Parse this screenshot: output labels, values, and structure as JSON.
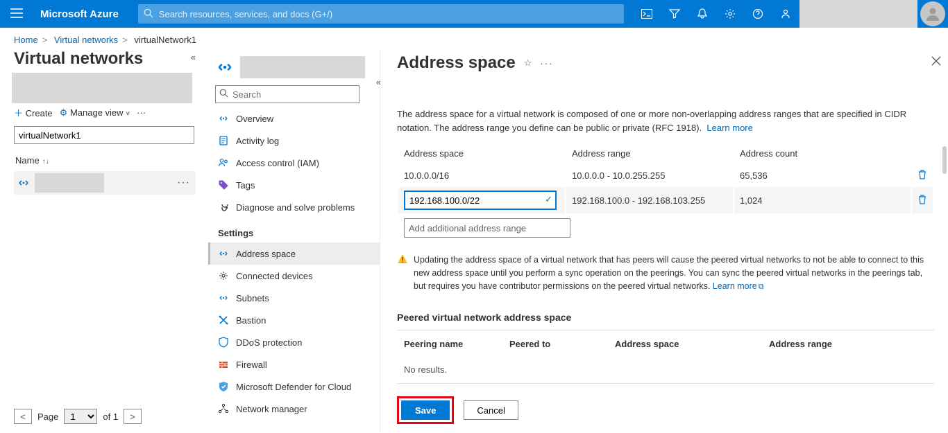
{
  "topbar": {
    "brand": "Microsoft Azure",
    "search_placeholder": "Search resources, services, and docs (G+/)"
  },
  "breadcrumb": {
    "home": "Home",
    "vnets": "Virtual networks",
    "current": "virtualNetwork1"
  },
  "col1": {
    "title": "Virtual networks",
    "create": "Create",
    "manage": "Manage view",
    "filter_value": "virtualNetwork1",
    "name_header": "Name",
    "pager": {
      "label": "Page",
      "cur": "1",
      "of": "of 1"
    }
  },
  "resource_menu": {
    "search_placeholder": "Search",
    "items": [
      {
        "label": "Overview"
      },
      {
        "label": "Activity log"
      },
      {
        "label": "Access control (IAM)"
      },
      {
        "label": "Tags"
      },
      {
        "label": "Diagnose and solve problems"
      }
    ],
    "settings_header": "Settings",
    "settings": [
      {
        "label": "Address space"
      },
      {
        "label": "Connected devices"
      },
      {
        "label": "Subnets"
      },
      {
        "label": "Bastion"
      },
      {
        "label": "DDoS protection"
      },
      {
        "label": "Firewall"
      },
      {
        "label": "Microsoft Defender for Cloud"
      },
      {
        "label": "Network manager"
      }
    ]
  },
  "page": {
    "title": "Address space",
    "description": "The address space for a virtual network is composed of one or more non-overlapping address ranges that are specified in CIDR notation. The address range you define can be public or private (RFC 1918).",
    "learn_more": "Learn more",
    "table_headers": {
      "space": "Address space",
      "range": "Address range",
      "count": "Address count"
    },
    "rows": [
      {
        "space": "10.0.0.0/16",
        "range": "10.0.0.0 - 10.0.255.255",
        "count": "65,536"
      },
      {
        "space": "192.168.100.0/22",
        "range": "192.168.100.0 - 192.168.103.255",
        "count": "1,024"
      }
    ],
    "add_placeholder": "Add additional address range",
    "warning": "Updating the address space of a virtual network that has peers will cause the peered virtual networks to not be able to connect to this new address space until you perform a sync operation on the peerings. You can sync the peered virtual networks in the peerings tab, but requires you have contributor permissions on the peered virtual networks.",
    "warning_learn": "Learn more",
    "peer_header": "Peered virtual network address space",
    "peer_table": {
      "name": "Peering name",
      "to": "Peered to",
      "space": "Address space",
      "range": "Address range",
      "empty": "No results."
    },
    "save": "Save",
    "cancel": "Cancel"
  }
}
